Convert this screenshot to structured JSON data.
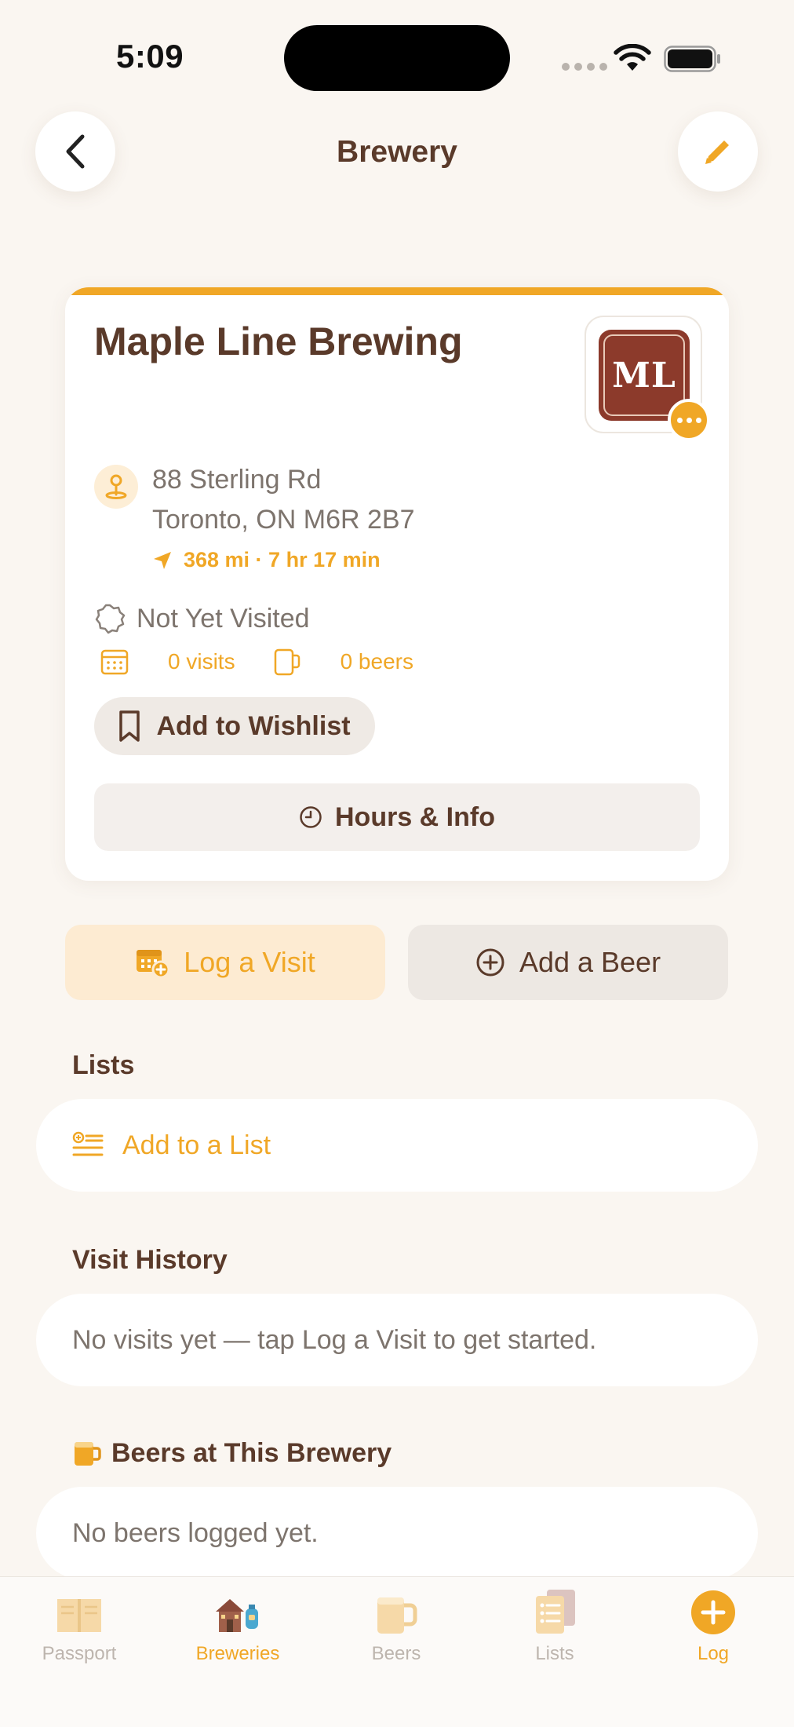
{
  "status_bar": {
    "time": "5:09"
  },
  "nav": {
    "title": "Brewery"
  },
  "brewery": {
    "name": "Maple Line Brewing",
    "logo_text": "ML",
    "address_line1": "88 Sterling Rd",
    "address_line2": "Toronto, ON M6R 2B7",
    "distance": "368 mi · 7 hr 17 min",
    "visit_status": "Not Yet Visited",
    "visits_count": "0 visits",
    "beers_count": "0 beers",
    "wishlist_label": "Add to Wishlist",
    "hours_label": "Hours & Info"
  },
  "actions": {
    "log_visit": "Log a Visit",
    "add_beer": "Add a Beer"
  },
  "lists": {
    "title": "Lists",
    "add_label": "Add to a List"
  },
  "visit_history": {
    "title": "Visit History",
    "empty": "No visits yet — tap Log a Visit to get started."
  },
  "beers": {
    "title": "Beers at This Brewery",
    "empty": "No beers logged yet."
  },
  "tabs": [
    {
      "label": "Passport",
      "icon": "passport-book-icon",
      "active": false
    },
    {
      "label": "Breweries",
      "icon": "brewery-house-icon",
      "active": true
    },
    {
      "label": "Beers",
      "icon": "beer-mug-icon",
      "active": false
    },
    {
      "label": "Lists",
      "icon": "list-icon",
      "active": false
    },
    {
      "label": "Log",
      "icon": "plus-circle-icon",
      "active": true
    }
  ],
  "colors": {
    "accent": "#f0a726",
    "text": "#5a3a2a",
    "background": "#faf6f1",
    "logo_bg": "#8c3a2b"
  }
}
